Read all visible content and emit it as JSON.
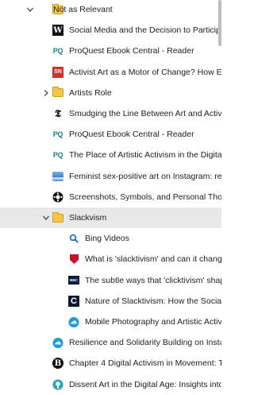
{
  "tree": [
    {
      "label": "Not as Relevant",
      "type": "folder",
      "expanded": true,
      "level": 0,
      "icon": "folder-icon"
    },
    {
      "label": "Social Media and the Decision to Participate",
      "type": "bookmark",
      "level": 1,
      "icon": "w-icon"
    },
    {
      "label": "ProQuest Ebook Central - Reader",
      "type": "bookmark",
      "level": 1,
      "icon": "proquest-icon"
    },
    {
      "label": "Activist Art as a Motor of Change? How Emo",
      "type": "bookmark",
      "level": 1,
      "icon": "sn-icon"
    },
    {
      "label": "Artists Role",
      "type": "folder",
      "expanded": false,
      "level": 1,
      "icon": "folder-icon"
    },
    {
      "label": "Smudging the Line Between Art and Activism",
      "type": "bookmark",
      "level": 1,
      "icon": "nyt-icon"
    },
    {
      "label": "ProQuest Ebook Central - Reader",
      "type": "bookmark",
      "level": 1,
      "icon": "proquest-icon"
    },
    {
      "label": "The Place of Artistic Activism in the Digital A",
      "type": "bookmark",
      "level": 1,
      "icon": "proquest-icon"
    },
    {
      "label": "Feminist sex-positive art on Instagram: reori",
      "type": "bookmark",
      "level": 1,
      "icon": "wave-icon"
    },
    {
      "label": "Screenshots, Symbols, and Personal Though",
      "type": "bookmark",
      "level": 1,
      "icon": "gear-icon"
    },
    {
      "label": "Slackvism",
      "type": "folder",
      "expanded": true,
      "level": 1,
      "icon": "folder-icon",
      "selected": true
    },
    {
      "label": "Bing Videos",
      "type": "bookmark",
      "level": 2,
      "icon": "search-icon"
    },
    {
      "label": "What is 'slacktivism' and can it change t",
      "type": "bookmark",
      "level": 2,
      "icon": "shield-icon"
    },
    {
      "label": "The subtle ways that 'clicktivism' shape",
      "type": "bookmark",
      "level": 2,
      "icon": "bbc-icon"
    },
    {
      "label": "Nature of Slacktivism: How the Social O",
      "type": "bookmark",
      "level": 2,
      "icon": "c-icon"
    },
    {
      "label": "Mobile Photography and Artistic Activis",
      "type": "bookmark",
      "level": 2,
      "icon": "cloud-icon"
    },
    {
      "label": "Resilience and Solidarity Building on Instagra",
      "type": "bookmark",
      "level": 1,
      "icon": "cloud-icon"
    },
    {
      "label": "Chapter 4 Digital Activism in Movement: The",
      "type": "bookmark",
      "level": 1,
      "icon": "b-icon"
    },
    {
      "label": "Dissent Art in the Digital Age: Insights into th",
      "type": "bookmark",
      "level": 1,
      "icon": "teal-icon"
    }
  ],
  "icon_glyphs": {
    "w": "W",
    "proquest": "PQ",
    "sn": "SN",
    "nyt": "𝕿",
    "b": "B",
    "c": "C",
    "bbc": "BBC"
  },
  "colors": {
    "selected_row": "#e8e8e8",
    "folder": "#f6c54a",
    "proquest": "#1a7f8f",
    "sn_red": "#d32f2f",
    "bing": "#1f6fd1",
    "cloud": "#1b9dd9",
    "teal": "#23a6b5"
  }
}
